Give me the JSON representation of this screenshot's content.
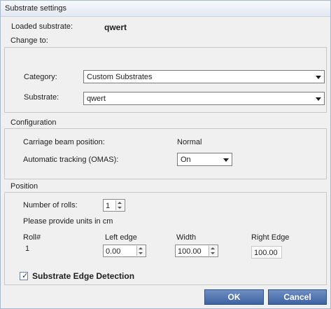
{
  "window": {
    "title": "Substrate settings"
  },
  "loaded": {
    "label": "Loaded substrate:",
    "value": "qwert"
  },
  "change_to": {
    "group_label": "Change to:",
    "category_label": "Category:",
    "category_value": "Custom Substrates",
    "substrate_label": "Substrate:",
    "substrate_value": "qwert"
  },
  "configuration": {
    "group_label": "Configuration",
    "beam_label": "Carriage beam position:",
    "beam_value": "Normal",
    "tracking_label": "Automatic tracking (OMAS):",
    "tracking_value": "On"
  },
  "position": {
    "group_label": "Position",
    "rolls_label": "Number of rolls:",
    "rolls_value": "1",
    "units_note": "Please provide units in cm",
    "headers": {
      "roll": "Roll#",
      "left_edge": "Left edge",
      "width": "Width",
      "right_edge": "Right Edge"
    },
    "rows": [
      {
        "roll": "1",
        "left_edge": "0.00",
        "width": "100.00",
        "right_edge": "100.00"
      }
    ]
  },
  "edge_detection": {
    "label": "Substrate Edge Detection",
    "checked": true
  },
  "buttons": {
    "ok": "OK",
    "cancel": "Cancel"
  },
  "colors": {
    "button": "#4a6fae",
    "title_bar": "#e3e9f2",
    "dialog_bg": "#f0f0f0"
  }
}
